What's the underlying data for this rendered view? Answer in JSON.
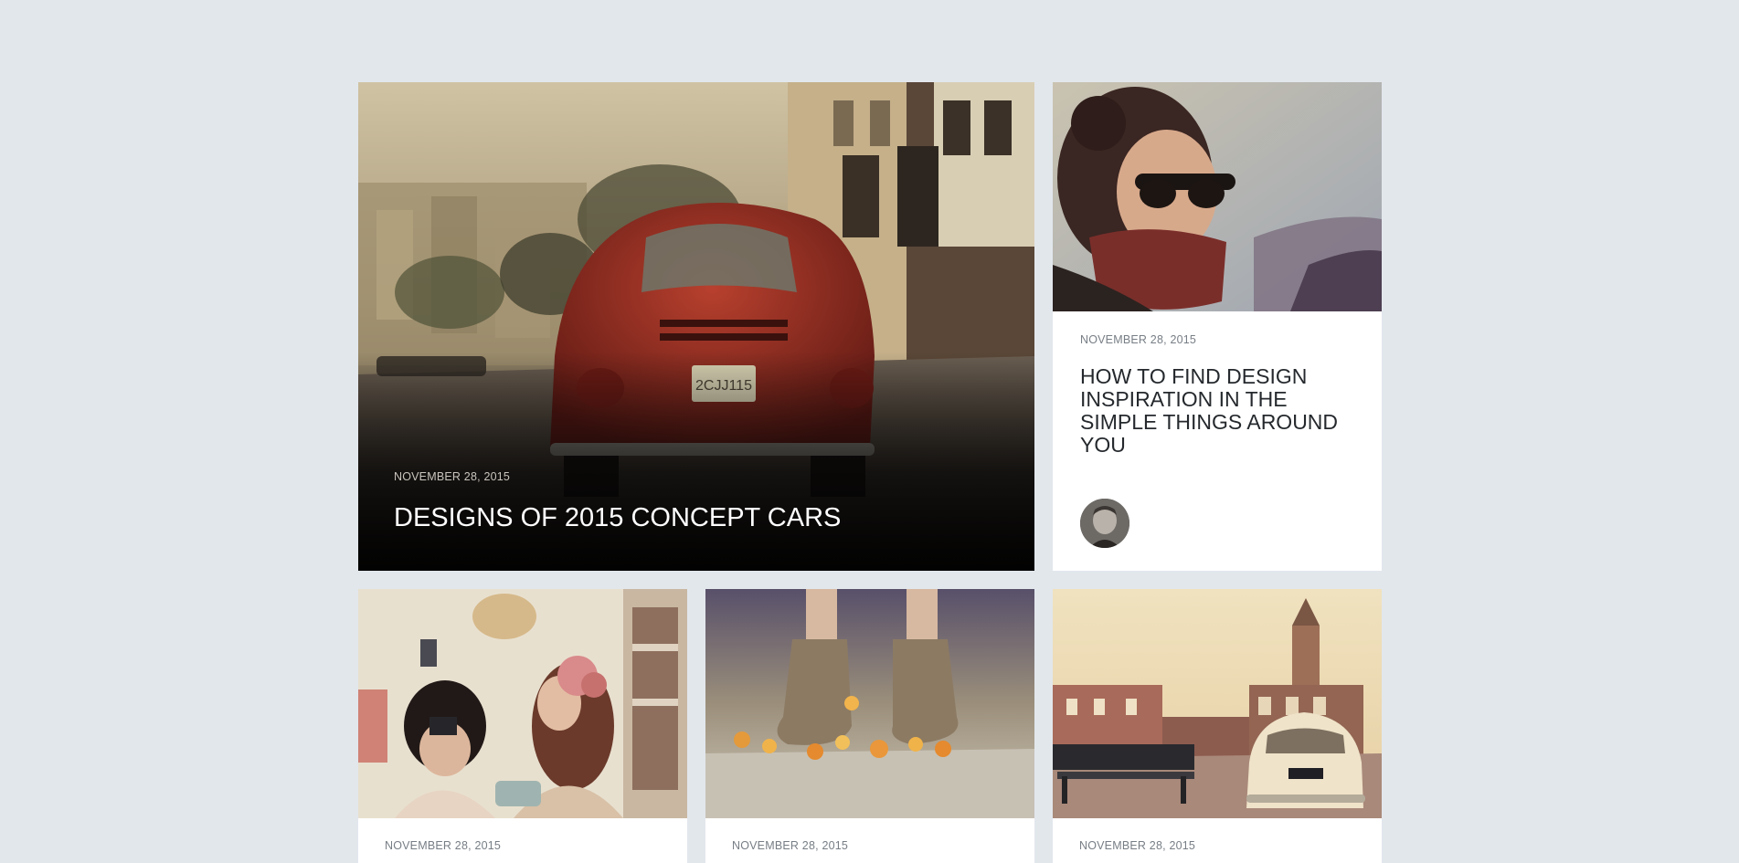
{
  "posts": [
    {
      "date": "NOVEMBER 28, 2015",
      "title": "DESIGNS OF 2015 CONCEPT CARS",
      "image": "red vintage beetle car on city street"
    },
    {
      "date": "NOVEMBER 28, 2015",
      "title": "HOW TO FIND DESIGN INSPIRATION IN THE SIMPLE THINGS AROUND YOU",
      "image": "woman with sunglasses and red scarf",
      "author_avatar": "author-avatar"
    },
    {
      "date": "NOVEMBER 28, 2015",
      "image": "two girls with camera and toy van"
    },
    {
      "date": "NOVEMBER 28, 2015",
      "image": "boots standing on flowers"
    },
    {
      "date": "NOVEMBER 28, 2015",
      "image": "vintage white car in town square"
    }
  ],
  "colors": {
    "page_background": "#e2e7ec",
    "card_background": "#ffffff",
    "date_text": "#777e85",
    "title_text": "#25292d"
  }
}
